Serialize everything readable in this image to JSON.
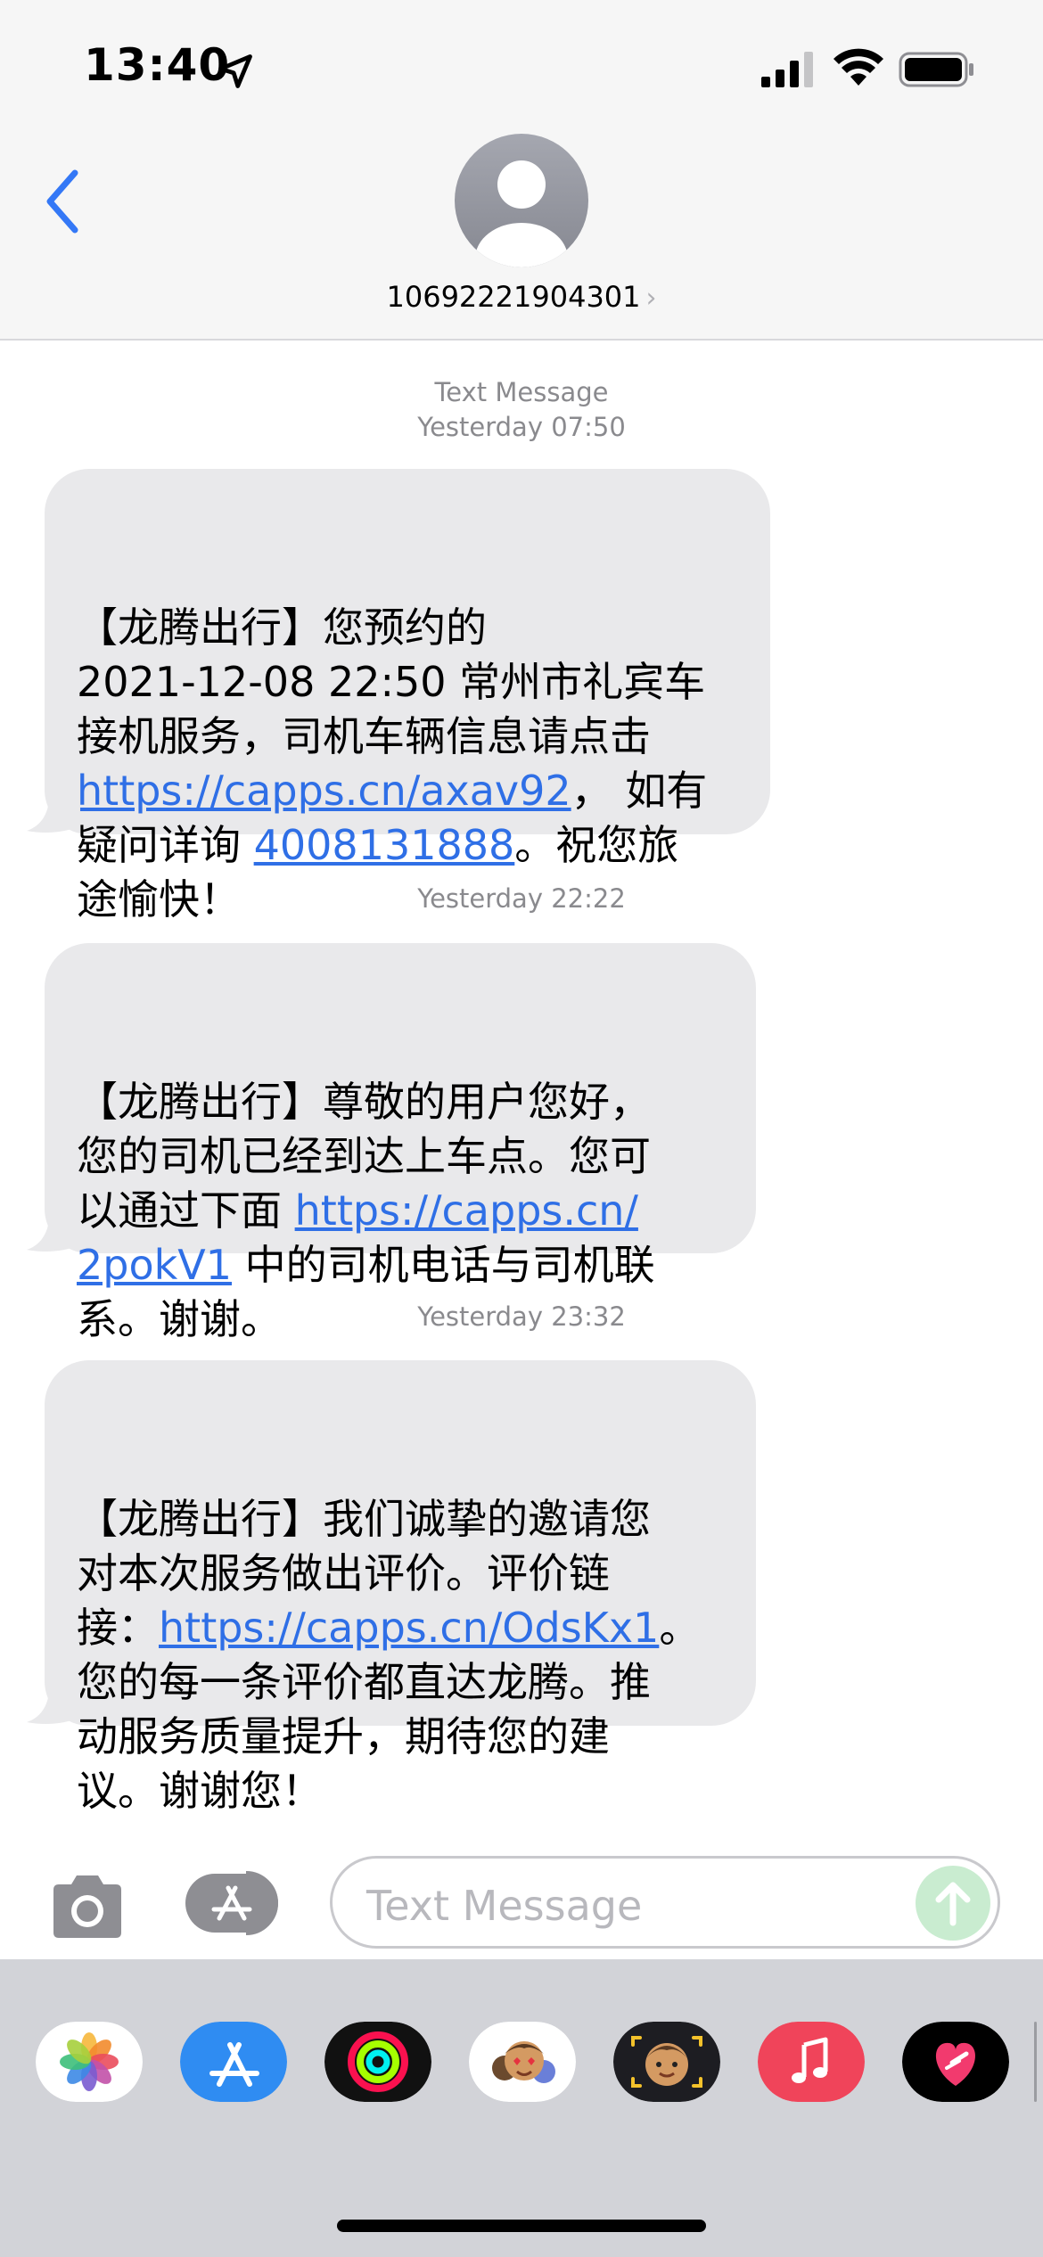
{
  "status_bar": {
    "time": "13:40"
  },
  "header": {
    "contact": "10692221904301"
  },
  "messages": [
    {
      "meta_label": "Text Message",
      "meta_time": "Yesterday 07:50",
      "lines": [
        [
          "【龙腾出行】您预约的"
        ],
        [
          "2021-12-08 22:50 常州市礼宾车"
        ],
        [
          "接机服务，司机车辆信息请点击"
        ],
        [
          "https://capps.cn/axav92",
          "， 如有"
        ],
        [
          "疑问详询 ",
          "4008131888",
          "。祝您旅"
        ],
        [
          "途愉快！"
        ]
      ]
    },
    {
      "meta_time": "Yesterday 22:22",
      "lines": [
        [
          "【龙腾出行】尊敬的用户您好，"
        ],
        [
          "您的司机已经到达上车点。您可"
        ],
        [
          "以通过下面 ",
          "https://capps.cn/"
        ],
        [
          "2pokV1",
          " 中的司机电话与司机联"
        ],
        [
          "系。谢谢。"
        ]
      ]
    },
    {
      "meta_time": "Yesterday 23:32",
      "lines": [
        [
          "【龙腾出行】我们诚挚的邀请您"
        ],
        [
          "对本次服务做出评价。评价链"
        ],
        [
          "接：",
          "https://capps.cn/OdsKx1",
          "。"
        ],
        [
          "您的每一条评价都直达龙腾。推"
        ],
        [
          "动服务质量提升，期待您的建"
        ],
        [
          "议。谢谢您！"
        ]
      ]
    }
  ],
  "input": {
    "placeholder": "Text Message"
  },
  "drawer": {
    "apps": [
      "photos-app",
      "app-store-app",
      "activity-app",
      "memoji-stickers-app",
      "animoji-app",
      "music-app",
      "heart-app"
    ]
  },
  "colors": {
    "link": "#2f6fe6",
    "bubble": "#e9e9eb",
    "accent": "#3478f6",
    "send": "#34c759"
  }
}
